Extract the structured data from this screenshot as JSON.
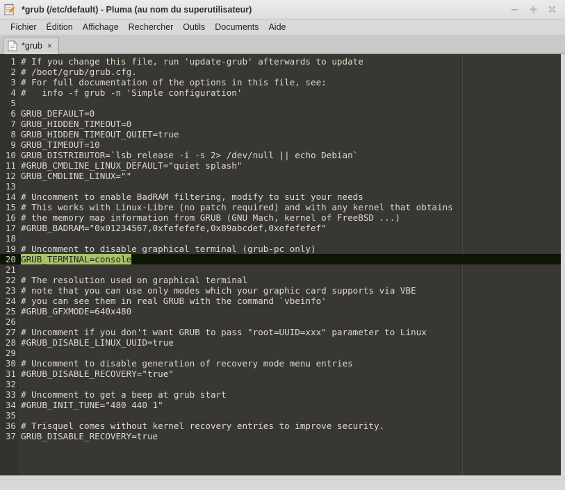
{
  "window": {
    "title": "*grub (/etc/default) - Pluma (au nom du superutilisateur)",
    "app_icon": "notepad-pencil-icon",
    "buttons": {
      "minimize": "minimize-icon",
      "maximize": "maximize-icon",
      "close": "close-icon"
    }
  },
  "menubar": {
    "items": [
      {
        "label": "Fichier"
      },
      {
        "label": "Édition"
      },
      {
        "label": "Affichage"
      },
      {
        "label": "Rechercher"
      },
      {
        "label": "Outils"
      },
      {
        "label": "Documents"
      },
      {
        "label": "Aide"
      }
    ]
  },
  "tabbar": {
    "tabs": [
      {
        "label": "*grub",
        "icon": "document-icon",
        "close": "×"
      }
    ]
  },
  "editor": {
    "colors": {
      "background": "#383734",
      "gutter_background": "#33322f",
      "text": "#ddd9d0",
      "selection": "#a7c46a",
      "selection_text": "#21251a",
      "current_line": "#0d1505",
      "margin_line": "#4a4844"
    },
    "current_line_number": 20,
    "selection_text": "GRUB_TERMINAL=console",
    "lines": [
      {
        "n": 1,
        "text": "# If you change this file, run 'update-grub' afterwards to update"
      },
      {
        "n": 2,
        "text": "# /boot/grub/grub.cfg."
      },
      {
        "n": 3,
        "text": "# For full documentation of the options in this file, see:"
      },
      {
        "n": 4,
        "text": "#   info -f grub -n 'Simple configuration'"
      },
      {
        "n": 5,
        "text": ""
      },
      {
        "n": 6,
        "text": "GRUB_DEFAULT=0"
      },
      {
        "n": 7,
        "text": "GRUB_HIDDEN_TIMEOUT=0"
      },
      {
        "n": 8,
        "text": "GRUB_HIDDEN_TIMEOUT_QUIET=true"
      },
      {
        "n": 9,
        "text": "GRUB_TIMEOUT=10"
      },
      {
        "n": 10,
        "text": "GRUB_DISTRIBUTOR=`lsb_release -i -s 2> /dev/null || echo Debian`"
      },
      {
        "n": 11,
        "text": "#GRUB_CMDLINE_LINUX_DEFAULT=\"quiet splash\""
      },
      {
        "n": 12,
        "text": "GRUB_CMDLINE_LINUX=\"\""
      },
      {
        "n": 13,
        "text": ""
      },
      {
        "n": 14,
        "text": "# Uncomment to enable BadRAM filtering, modify to suit your needs"
      },
      {
        "n": 15,
        "text": "# This works with Linux-Libre (no patch required) and with any kernel that obtains"
      },
      {
        "n": 16,
        "text": "# the memory map information from GRUB (GNU Mach, kernel of FreeBSD ...)"
      },
      {
        "n": 17,
        "text": "#GRUB_BADRAM=\"0x01234567,0xfefefefe,0x89abcdef,0xefefefef\""
      },
      {
        "n": 18,
        "text": ""
      },
      {
        "n": 19,
        "text": "# Uncomment to disable graphical terminal (grub-pc only)"
      },
      {
        "n": 20,
        "text": "GRUB_TERMINAL=console",
        "selected": true,
        "current": true
      },
      {
        "n": 21,
        "text": ""
      },
      {
        "n": 22,
        "text": "# The resolution used on graphical terminal"
      },
      {
        "n": 23,
        "text": "# note that you can use only modes which your graphic card supports via VBE"
      },
      {
        "n": 24,
        "text": "# you can see them in real GRUB with the command `vbeinfo'"
      },
      {
        "n": 25,
        "text": "#GRUB_GFXMODE=640x480"
      },
      {
        "n": 26,
        "text": ""
      },
      {
        "n": 27,
        "text": "# Uncomment if you don't want GRUB to pass \"root=UUID=xxx\" parameter to Linux"
      },
      {
        "n": 28,
        "text": "#GRUB_DISABLE_LINUX_UUID=true"
      },
      {
        "n": 29,
        "text": ""
      },
      {
        "n": 30,
        "text": "# Uncomment to disable generation of recovery mode menu entries"
      },
      {
        "n": 31,
        "text": "#GRUB_DISABLE_RECOVERY=\"true\""
      },
      {
        "n": 32,
        "text": ""
      },
      {
        "n": 33,
        "text": "# Uncomment to get a beep at grub start"
      },
      {
        "n": 34,
        "text": "#GRUB_INIT_TUNE=\"480 440 1\""
      },
      {
        "n": 35,
        "text": ""
      },
      {
        "n": 36,
        "text": "# Trisquel comes without kernel recovery entries to improve security."
      },
      {
        "n": 37,
        "text": "GRUB_DISABLE_RECOVERY=true"
      }
    ]
  }
}
